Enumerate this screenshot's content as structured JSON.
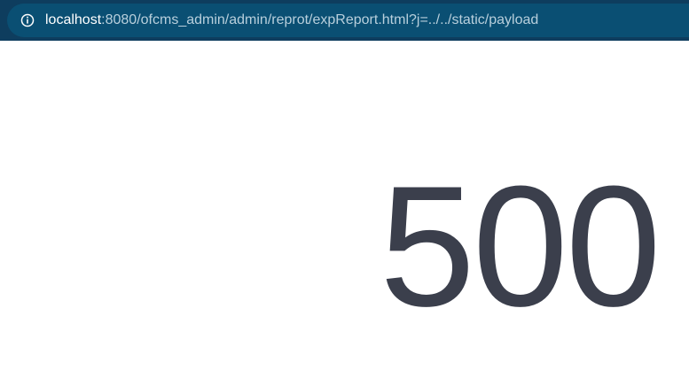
{
  "browser": {
    "address_bar": {
      "host": "localhost",
      "path": ":8080/ofcms_admin/admin/reprot/expReport.html?j=../../static/payload",
      "icon": "info-icon"
    }
  },
  "page": {
    "error_code": "500"
  },
  "colors": {
    "chrome_background": "#0e3d5e",
    "address_bar_background": "#0a4f73",
    "host_text": "#ffffff",
    "path_text": "#b8cfdc",
    "error_code_text": "#3b3f4c"
  }
}
